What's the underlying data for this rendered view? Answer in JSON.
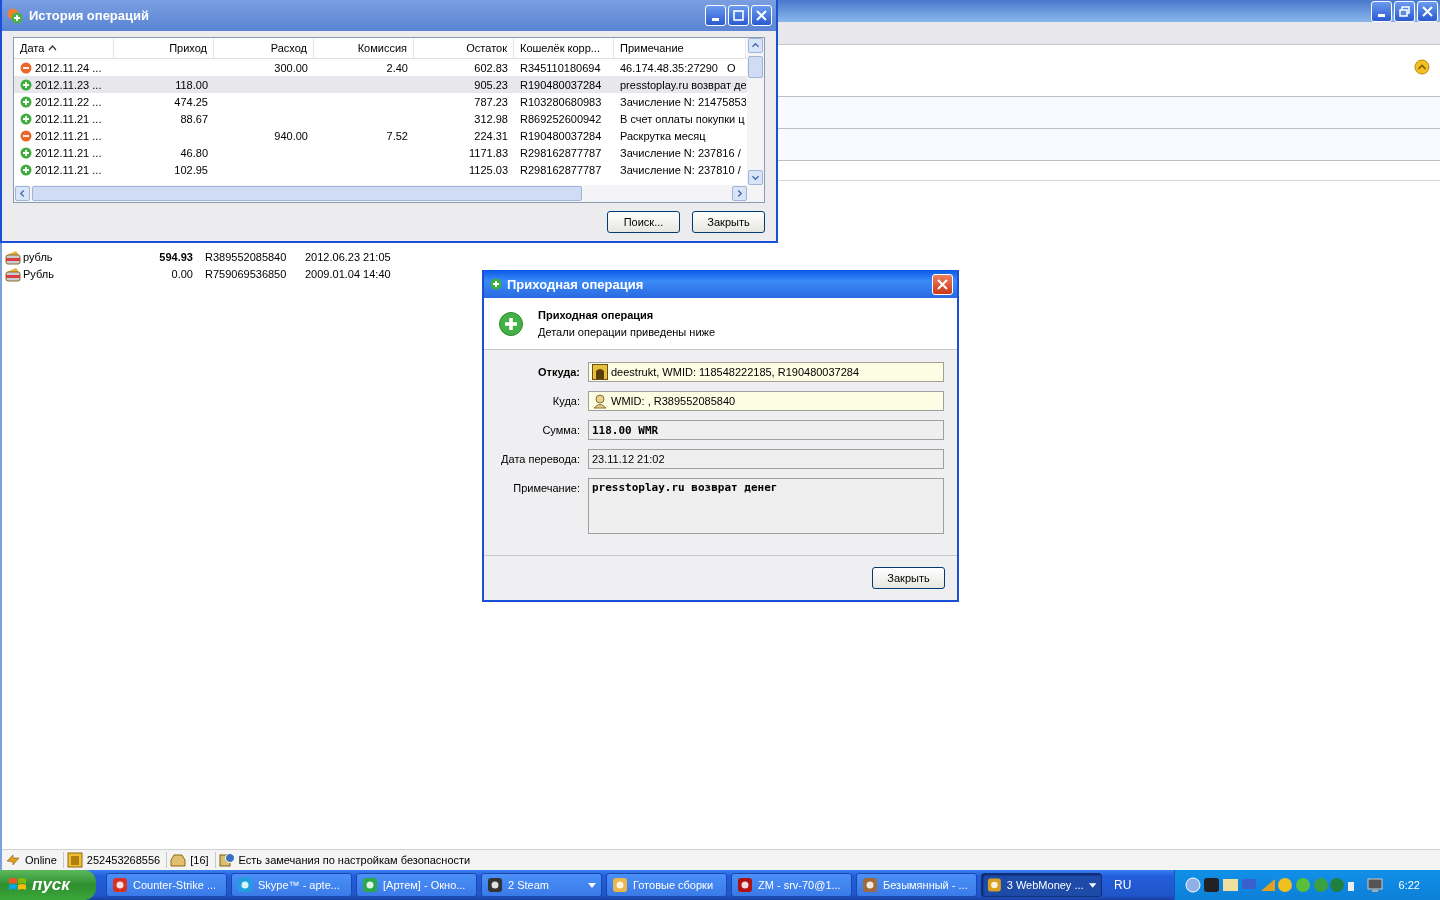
{
  "history_window": {
    "title": "История операций",
    "columns": [
      {
        "label": "Дата",
        "sorted": true
      },
      {
        "label": "Приход",
        "sorted": false
      },
      {
        "label": "Расход",
        "sorted": false
      },
      {
        "label": "Комиссия",
        "sorted": false
      },
      {
        "label": "Остаток",
        "sorted": false
      },
      {
        "label": "Кошелёк корр...",
        "sorted": false
      },
      {
        "label": "Примечание",
        "sorted": false
      }
    ],
    "rows": [
      {
        "kind": "out",
        "selected": false,
        "cells": [
          "2012.11.24 ...",
          "",
          "300.00",
          "2.40",
          "602.83",
          "R345110180694",
          "46.174.48.35:27290   О"
        ]
      },
      {
        "kind": "in",
        "selected": true,
        "cells": [
          "2012.11.23 ...",
          "118.00",
          "",
          "",
          "905.23",
          "R190480037284",
          "presstoplay.ru возврат де"
        ]
      },
      {
        "kind": "in",
        "selected": false,
        "cells": [
          "2012.11.22 ...",
          "474.25",
          "",
          "",
          "787.23",
          "R103280680983",
          "Зачисление N: 21475853"
        ]
      },
      {
        "kind": "in",
        "selected": false,
        "cells": [
          "2012.11.21 ...",
          "88.67",
          "",
          "",
          "312.98",
          "R869252600942",
          "В счет оплаты покупки ц"
        ]
      },
      {
        "kind": "out",
        "selected": false,
        "cells": [
          "2012.11.21 ...",
          "",
          "940.00",
          "7.52",
          "224.31",
          "R190480037284",
          "Раскрутка месяц"
        ]
      },
      {
        "kind": "in",
        "selected": false,
        "cells": [
          "2012.11.21 ...",
          "46.80",
          "",
          "",
          "1171.83",
          "R298162877787",
          "Зачисление N: 237816 /"
        ]
      },
      {
        "kind": "in",
        "selected": false,
        "cells": [
          "2012.11.21 ...",
          "102.95",
          "",
          "",
          "1125.03",
          "R298162877787",
          "Зачисление N: 237810 /"
        ]
      }
    ],
    "buttons": [
      "Поиск...",
      "Закрыть"
    ]
  },
  "wallets": [
    {
      "name": "рубль",
      "amount": "594.93",
      "bold": true,
      "purse": "R389552085840",
      "date": "2012.06.23 21:05"
    },
    {
      "name": "Рубль",
      "amount": "0.00",
      "bold": false,
      "purse": "R759069536850",
      "date": "2009.01.04 14:40"
    }
  ],
  "dialog": {
    "title": "Приходная операция",
    "heading": "Приходная операция",
    "subheading": "Детали операции приведены ниже",
    "fields": [
      {
        "label": "Откуда:",
        "label_bold": true,
        "value": "deestrukt, WMID: 118548222185, R190480037284",
        "value_bold": false,
        "kind": "wallet"
      },
      {
        "label": "Куда:",
        "label_bold": false,
        "value": "WMID: , R389552085840",
        "value_bold": false,
        "kind": "person"
      },
      {
        "label": "Сумма:",
        "label_bold": false,
        "value": "118.00 WMR",
        "value_bold": true,
        "kind": "plain"
      },
      {
        "label": "Дата перевода:",
        "label_bold": false,
        "value": "23.11.12 21:02",
        "value_bold": false,
        "kind": "plain"
      },
      {
        "label": "Примечание:",
        "label_bold": false,
        "value": "presstoplay.ru возврат денег",
        "value_bold": true,
        "kind": "note"
      }
    ],
    "button": "Закрыть"
  },
  "status_bar": [
    {
      "kind": "online",
      "text": "Online"
    },
    {
      "kind": "wmid",
      "text": "252453268556"
    },
    {
      "kind": "messages",
      "text": "[16]"
    },
    {
      "kind": "security",
      "text": "Есть замечания по настройкам безопасности"
    }
  ],
  "taskbar": {
    "start": "пуск",
    "items": [
      {
        "label": "Counter-Strike ...",
        "selected": false,
        "grouped": false
      },
      {
        "label": "Skype™ - apte...",
        "selected": false,
        "grouped": false
      },
      {
        "label": "[Артем] - Окно...",
        "selected": false,
        "grouped": false
      },
      {
        "label": "2 Steam",
        "selected": false,
        "grouped": true
      },
      {
        "label": "Готовые сборки",
        "selected": false,
        "grouped": false
      },
      {
        "label": "ZM - srv-70@1...",
        "selected": false,
        "grouped": false
      },
      {
        "label": "Безымянный - ...",
        "selected": false,
        "grouped": false
      },
      {
        "label": "3 WebMoney ...",
        "selected": true,
        "grouped": true
      }
    ],
    "language": "RU",
    "clock": "6:22"
  }
}
